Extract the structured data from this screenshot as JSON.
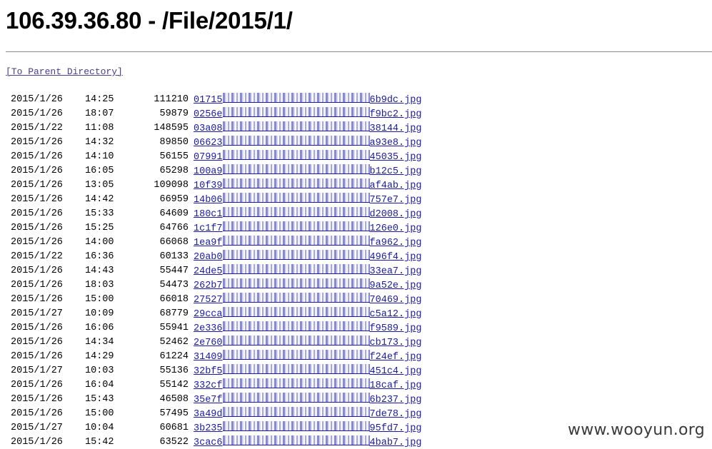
{
  "header": {
    "title": "106.39.36.80 - /File/2015/1/"
  },
  "parent_link": {
    "label": "[To Parent Directory]"
  },
  "files": [
    {
      "date": "2015/1/26",
      "time": "14:25",
      "size": "111210",
      "name_start": "01715",
      "name_end": "6b9dc.jpg"
    },
    {
      "date": "2015/1/26",
      "time": "18:07",
      "size": "59879",
      "name_start": "0256e",
      "name_end": "f9bc2.jpg"
    },
    {
      "date": "2015/1/22",
      "time": "11:08",
      "size": "148595",
      "name_start": "03a08",
      "name_end": "38144.jpg"
    },
    {
      "date": "2015/1/26",
      "time": "14:32",
      "size": "89850",
      "name_start": "06623",
      "name_end": "a93e8.jpg"
    },
    {
      "date": "2015/1/26",
      "time": "14:10",
      "size": "56155",
      "name_start": "07991",
      "name_end": "45035.jpg"
    },
    {
      "date": "2015/1/26",
      "time": "16:05",
      "size": "65298",
      "name_start": "100a9",
      "name_end": "b12c5.jpg"
    },
    {
      "date": "2015/1/26",
      "time": "13:05",
      "size": "109098",
      "name_start": "10f39",
      "name_end": "af4ab.jpg"
    },
    {
      "date": "2015/1/26",
      "time": "14:42",
      "size": "66959",
      "name_start": "14b06",
      "name_end": "757e7.jpg"
    },
    {
      "date": "2015/1/26",
      "time": "15:33",
      "size": "64609",
      "name_start": "180c1",
      "name_end": "d2008.jpg"
    },
    {
      "date": "2015/1/26",
      "time": "15:25",
      "size": "64766",
      "name_start": "1c1f7",
      "name_end": "126e0.jpg"
    },
    {
      "date": "2015/1/26",
      "time": "14:00",
      "size": "66068",
      "name_start": "1ea9f",
      "name_end": "fa962.jpg"
    },
    {
      "date": "2015/1/22",
      "time": "16:36",
      "size": "60133",
      "name_start": "20ab0",
      "name_end": "496f4.jpg"
    },
    {
      "date": "2015/1/26",
      "time": "14:43",
      "size": "55447",
      "name_start": "24de5",
      "name_end": "33ea7.jpg"
    },
    {
      "date": "2015/1/26",
      "time": "18:03",
      "size": "54473",
      "name_start": "262b7",
      "name_end": "9a52e.jpg"
    },
    {
      "date": "2015/1/26",
      "time": "15:00",
      "size": "66018",
      "name_start": "27527",
      "name_end": "70469.jpg"
    },
    {
      "date": "2015/1/27",
      "time": "10:09",
      "size": "68779",
      "name_start": "29cca",
      "name_end": "c5a12.jpg"
    },
    {
      "date": "2015/1/26",
      "time": "16:06",
      "size": "55941",
      "name_start": "2e336",
      "name_end": "f9589.jpg"
    },
    {
      "date": "2015/1/26",
      "time": "14:34",
      "size": "52462",
      "name_start": "2e760",
      "name_end": "cb173.jpg"
    },
    {
      "date": "2015/1/26",
      "time": "14:29",
      "size": "61224",
      "name_start": "31409",
      "name_end": "f24ef.jpg"
    },
    {
      "date": "2015/1/27",
      "time": "10:03",
      "size": "55136",
      "name_start": "32bf5",
      "name_end": "451c4.jpg"
    },
    {
      "date": "2015/1/26",
      "time": "16:04",
      "size": "55142",
      "name_start": "332cf",
      "name_end": "18caf.jpg"
    },
    {
      "date": "2015/1/26",
      "time": "15:43",
      "size": "46508",
      "name_start": "35e7f",
      "name_end": "6b237.jpg"
    },
    {
      "date": "2015/1/26",
      "time": "15:00",
      "size": "57495",
      "name_start": "3a49d",
      "name_end": "7de78.jpg"
    },
    {
      "date": "2015/1/27",
      "time": "10:04",
      "size": "60681",
      "name_start": "3b235",
      "name_end": "95fd7.jpg"
    },
    {
      "date": "2015/1/26",
      "time": "15:42",
      "size": "63522",
      "name_start": "3cac6",
      "name_end": "4bab7.jpg"
    }
  ],
  "watermark": "www.wooyun.org",
  "colors": {
    "link": "#1a1aa6",
    "visited_link": "#4a3d8a",
    "rule": "#8a8a8a"
  }
}
